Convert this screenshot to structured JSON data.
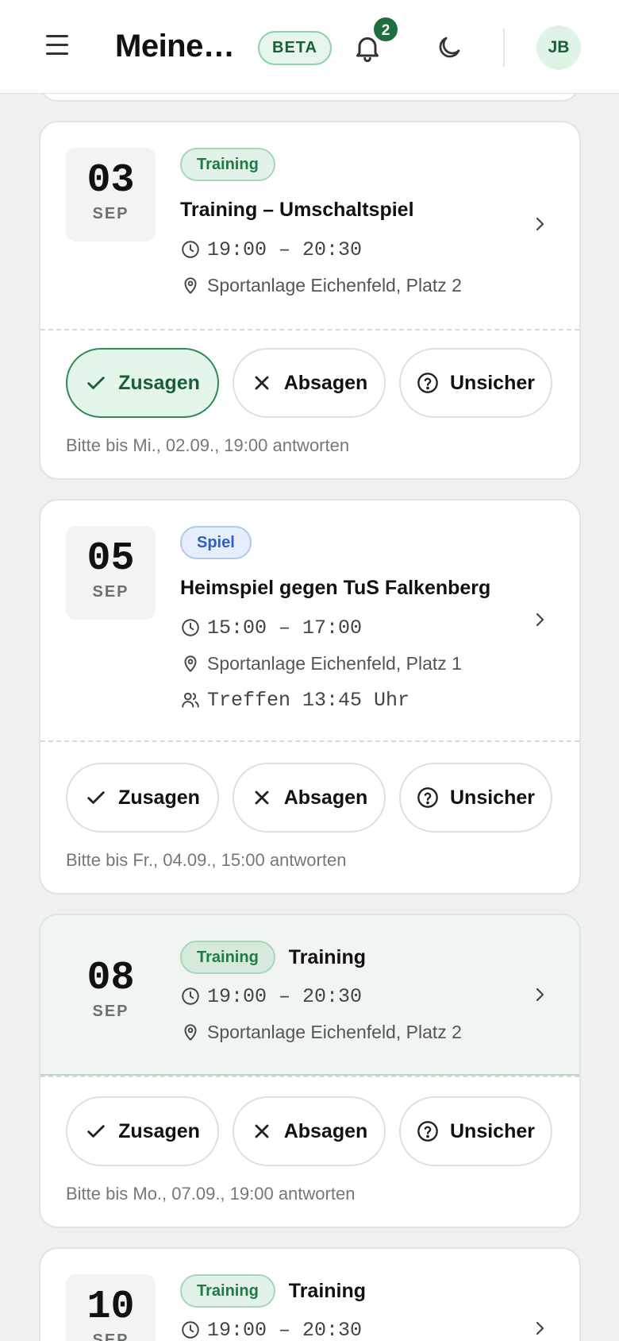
{
  "header": {
    "title": "Meine…",
    "beta": "BETA",
    "notification_count": "2",
    "avatar_initials": "JB"
  },
  "events": [
    {
      "day": "03",
      "month": "SEP",
      "tag": "Training",
      "title": "Training – Umschaltspiel",
      "time": "19:00 – 20:30",
      "location": "Sportanlage Eichenfeld, Platz 2",
      "accept": "Zusagen",
      "decline": "Absagen",
      "unsure": "Unsicher",
      "deadline": "Bitte bis Mi., 02.09., 19:00 antworten"
    },
    {
      "day": "05",
      "month": "SEP",
      "tag": "Spiel",
      "title": "Heimspiel gegen TuS Falkenberg",
      "time": "15:00 – 17:00",
      "location": "Sportanlage Eichenfeld, Platz 1",
      "meeting": "Treffen 13:45 Uhr",
      "accept": "Zusagen",
      "decline": "Absagen",
      "unsure": "Unsicher",
      "deadline": "Bitte bis Fr., 04.09., 15:00 antworten"
    },
    {
      "day": "08",
      "month": "SEP",
      "tag": "Training",
      "title": "Training",
      "time": "19:00 – 20:30",
      "location": "Sportanlage Eichenfeld, Platz 2",
      "accept": "Zusagen",
      "decline": "Absagen",
      "unsure": "Unsicher",
      "deadline": "Bitte bis Mo., 07.09., 19:00 antworten"
    },
    {
      "day": "10",
      "month": "SEP",
      "tag": "Training",
      "title": "Training",
      "time": "19:00 – 20:30"
    }
  ],
  "colors": {
    "accent_green": "#1e6e42",
    "spiel_blue": "#2e5fc4",
    "background": "#eef1ee"
  }
}
